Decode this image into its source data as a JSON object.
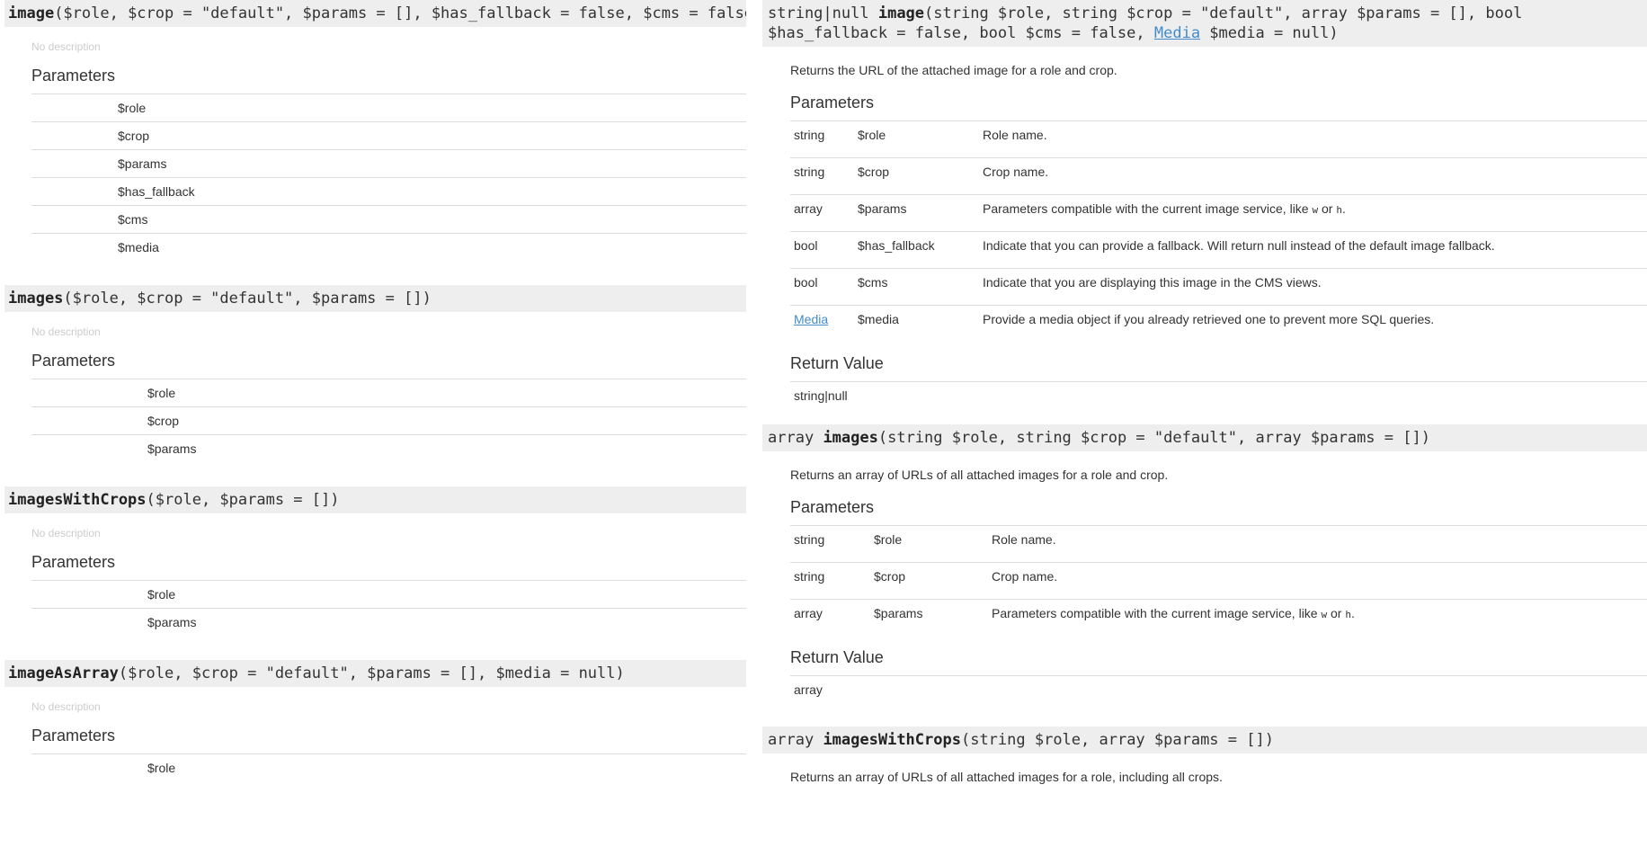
{
  "left_methods": [
    {
      "name": "image",
      "args": "($role, $crop = \"default\", $params = [], $has_fallback = false, $cms = false, $media = null)",
      "description": "No description",
      "params_heading": "Parameters",
      "params": [
        "$role",
        "$crop",
        "$params",
        "$has_fallback",
        "$cms",
        "$media"
      ]
    },
    {
      "name": "images",
      "args": "($role, $crop = \"default\", $params = [])",
      "description": "No description",
      "params_heading": "Parameters",
      "params": [
        "$role",
        "$crop",
        "$params"
      ]
    },
    {
      "name": "imagesWithCrops",
      "args": "($role, $params = [])",
      "description": "No description",
      "params_heading": "Parameters",
      "params": [
        "$role",
        "$params"
      ]
    },
    {
      "name": "imageAsArray",
      "args": "($role, $crop = \"default\", $params = [], $media = null)",
      "description": "No description",
      "params_heading": "Parameters",
      "params": [
        "$role"
      ]
    }
  ],
  "right_methods": [
    {
      "return_type": "string|null",
      "name": "image",
      "args_before_link": "(string $role, string $crop = \"default\", array $params = [], bool $has_fallback = false, bool $cms = false, ",
      "link_text": "Media",
      "args_after_link": " $media = null)",
      "description": "Returns the URL of the attached image for a role and crop.",
      "params_heading": "Parameters",
      "params": [
        {
          "type": "string",
          "name": "$role",
          "desc": "Role name."
        },
        {
          "type": "string",
          "name": "$crop",
          "desc": "Crop name."
        },
        {
          "type": "array",
          "name": "$params",
          "desc": "Parameters compatible with the current image service, like ",
          "code1": "w",
          "mid": " or ",
          "code2": "h",
          "end": "."
        },
        {
          "type": "bool",
          "name": "$has_fallback",
          "desc": "Indicate that you can provide a fallback. Will return null instead of the default image fallback."
        },
        {
          "type": "bool",
          "name": "$cms",
          "desc": "Indicate that you are displaying this image in the CMS views."
        },
        {
          "type": "Media",
          "type_link": true,
          "name": "$media",
          "desc": "Provide a media object if you already retrieved one to prevent more SQL queries."
        }
      ],
      "return_heading": "Return Value",
      "return_value": "string|null"
    },
    {
      "return_type": "array",
      "name": "images",
      "args": "(string $role, string $crop = \"default\", array $params = [])",
      "description": "Returns an array of URLs of all attached images for a role and crop.",
      "params_heading": "Parameters",
      "params": [
        {
          "type": "string",
          "name": "$role",
          "desc": "Role name."
        },
        {
          "type": "string",
          "name": "$crop",
          "desc": "Crop name."
        },
        {
          "type": "array",
          "name": "$params",
          "desc": "Parameters compatible with the current image service, like ",
          "code1": "w",
          "mid": " or ",
          "code2": "h",
          "end": "."
        }
      ],
      "return_heading": "Return Value",
      "return_value": "array"
    },
    {
      "return_type": "array",
      "name": "imagesWithCrops",
      "args": "(string $role, array $params = [])",
      "description": "Returns an array of URLs of all attached images for a role, including all crops."
    }
  ]
}
